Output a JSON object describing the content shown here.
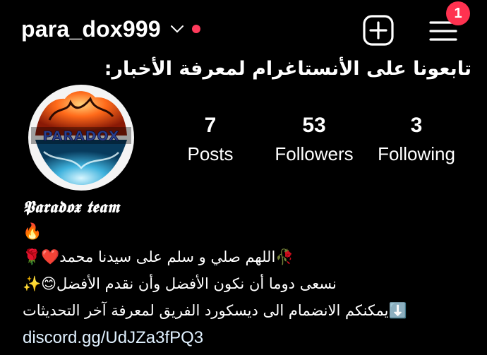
{
  "header": {
    "username": "para_dox999",
    "icons": {
      "chevron": "chevron-down-icon",
      "new_post": "add-post-icon",
      "menu": "hamburger-menu-icon"
    },
    "notification_count": "1",
    "colors": {
      "background": "#000000",
      "text": "#ffffff",
      "badge": "#ff3250",
      "dot": "#ff3b5c"
    }
  },
  "announcement": "تابعونا على الأنستاغرام لمعرفة الأخبار:",
  "profile": {
    "avatar_text": "PARADOX",
    "stats": {
      "posts": {
        "count": "7",
        "label": "Posts"
      },
      "followers": {
        "count": "53",
        "label": "Followers"
      },
      "following": {
        "count": "3",
        "label": "Following"
      }
    },
    "display_name": "𝕻𝖆𝖗𝖆𝖉𝖔𝖝 𝖙𝖊𝖆𝖒",
    "bio": {
      "emoji_line": "🔥",
      "line1": "🥀اللهم صلي و سلم على سيدنا محمد❤️🌹",
      "line2": "نسعى دوما أن نكون الأفضل وأن نقدم الأفضل😊✨",
      "line3": "⬇️يمكنكم الانضمام الى ديسكورد الفريق لمعرفة آخر التحديثات"
    },
    "link": "discord.gg/UdJZa3fPQ3"
  }
}
